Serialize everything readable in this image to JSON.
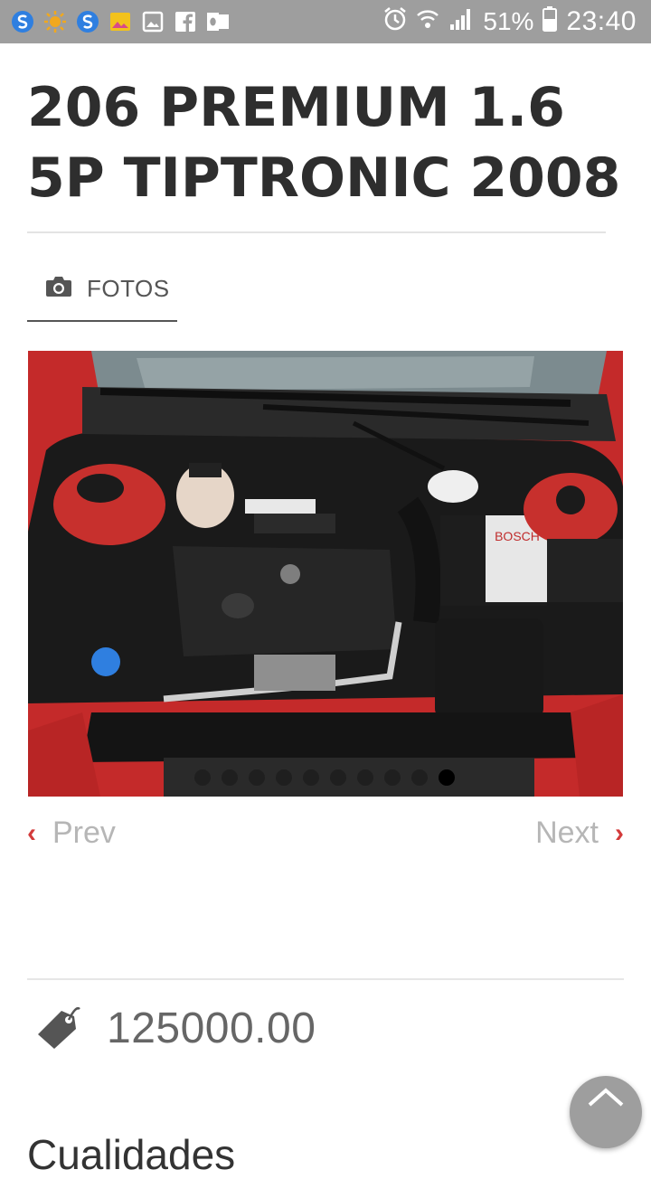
{
  "status_bar": {
    "battery": "51%",
    "time": "23:40",
    "icons": [
      "s-app-icon",
      "sun-icon",
      "s-app-icon",
      "gallery-icon",
      "image-icon",
      "facebook-icon",
      "outlook-icon",
      "alarm-icon",
      "wifi-icon",
      "signal-icon",
      "battery-icon"
    ]
  },
  "page": {
    "title": "206 PREMIUM 1.6 5P TIPTRONIC 2008"
  },
  "tabs": {
    "photos_label": "FOTOS"
  },
  "carousel": {
    "slide_count": 10,
    "active_slide": 10,
    "prev_label": "Prev",
    "next_label": "Next",
    "accent": "#d33b3b"
  },
  "price": {
    "value": "125000.00"
  },
  "sections": {
    "qualities_heading": "Cualidades"
  }
}
